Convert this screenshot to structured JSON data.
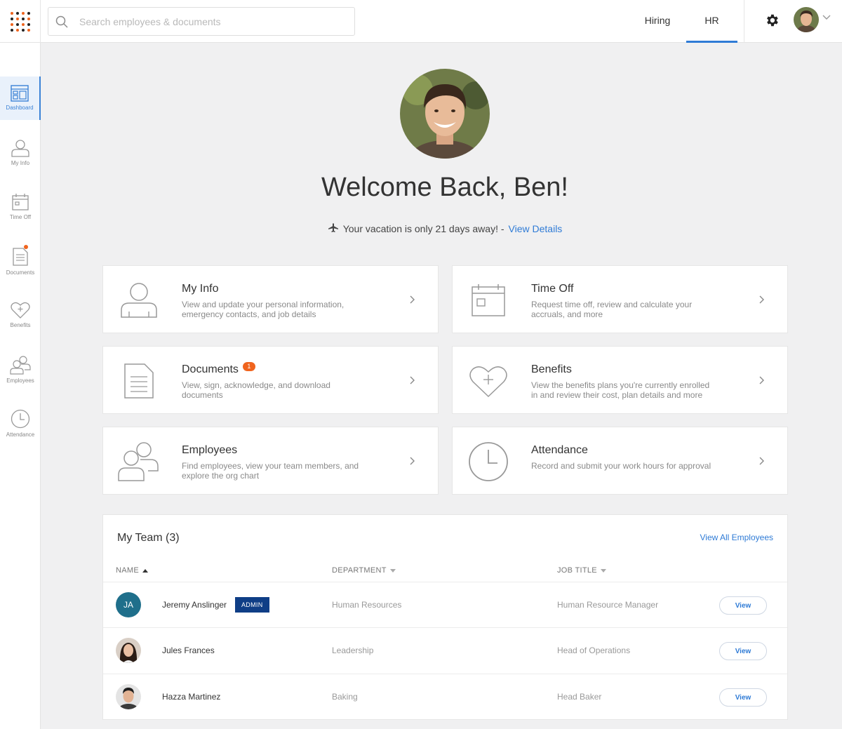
{
  "header": {
    "search_placeholder": "Search employees & documents",
    "tabs": [
      {
        "label": "Hiring",
        "active": false
      },
      {
        "label": "HR",
        "active": true
      }
    ]
  },
  "sidebar": {
    "items": [
      {
        "label": "Dashboard",
        "icon": "dashboard-icon",
        "active": true
      },
      {
        "label": "My Info",
        "icon": "person-icon"
      },
      {
        "label": "Time Off",
        "icon": "calendar-icon"
      },
      {
        "label": "Documents",
        "icon": "document-icon",
        "has_badge": true
      },
      {
        "label": "Benefits",
        "icon": "heart-plus-icon"
      },
      {
        "label": "Employees",
        "icon": "people-icon"
      },
      {
        "label": "Attendance",
        "icon": "clock-icon"
      }
    ]
  },
  "welcome": {
    "title": "Welcome Back, Ben!",
    "vacation_text": "Your vacation is only 21 days away! -",
    "vacation_link": "View Details"
  },
  "cards": [
    {
      "title": "My Info",
      "desc": "View and update your personal information, emergency contacts, and job details",
      "icon": "person-icon"
    },
    {
      "title": "Time Off",
      "desc": "Request time off, review and calculate your accruals, and more",
      "icon": "calendar-icon"
    },
    {
      "title": "Documents",
      "badge": "1",
      "desc": "View, sign, acknowledge, and download documents",
      "icon": "document-icon"
    },
    {
      "title": "Benefits",
      "desc": "View the benefits plans you're currently enrolled in and review their cost, plan details and more",
      "icon": "heart-plus-icon"
    },
    {
      "title": "Employees",
      "desc": "Find employees, view your team members, and explore the org chart",
      "icon": "people-icon"
    },
    {
      "title": "Attendance",
      "desc": "Record and submit your work hours for approval",
      "icon": "clock-icon"
    }
  ],
  "team": {
    "title": "My Team (3)",
    "view_all": "View All Employees",
    "columns": {
      "name": "NAME",
      "department": "DEPARTMENT",
      "job_title": "JOB TITLE"
    },
    "rows": [
      {
        "initials": "JA",
        "name": "Jeremy Anslinger",
        "admin": "ADMIN",
        "department": "Human Resources",
        "job_title": "Human Resource Manager",
        "action": "View",
        "avatar_color": "#1f6f8b"
      },
      {
        "initials": "",
        "name": "Jules Frances",
        "department": "Leadership",
        "job_title": "Head of Operations",
        "action": "View"
      },
      {
        "initials": "",
        "name": "Hazza Martinez",
        "department": "Baking",
        "job_title": "Head Baker",
        "action": "View"
      }
    ]
  },
  "colors": {
    "accent": "#2f7bd6",
    "badge": "#f0641e",
    "admin": "#0f3e86"
  }
}
